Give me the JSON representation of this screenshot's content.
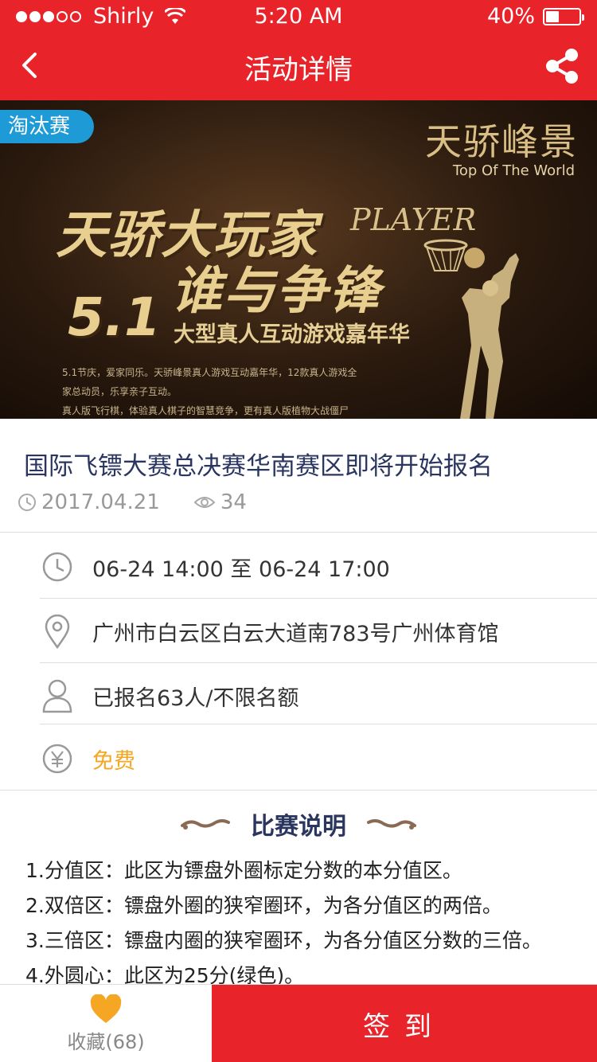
{
  "status_bar": {
    "carrier": "Shirly",
    "time": "5:20 AM",
    "battery": "40%",
    "battery_level": 0.4
  },
  "nav": {
    "title": "活动详情",
    "back_icon": "chevron-left-icon",
    "share_icon": "share-icon"
  },
  "banner": {
    "tag": "淘汰赛",
    "brand_cn": "天骄峰景",
    "brand_en": "Top Of The World",
    "headline_1": "天骄大玩家",
    "player_word": "PLAYER",
    "headline_2": "谁与争锋",
    "big_date": "5.1",
    "sub_headline": "大型真人互动游戏嘉年华",
    "copy_line_1": "5.1节庆，爱家同乐。天骄峰景真人游戏互动嘉年华，12款真人游戏全",
    "copy_line_2": "家总动员，乐享亲子互动。",
    "copy_line_3": "真人版飞行棋，体验真人棋子的智慧竞争，更有真人版植物大战僵尸"
  },
  "event": {
    "title": "国际飞镖大赛总决赛华南赛区即将开始报名",
    "date": "2017.04.21",
    "views": "34"
  },
  "details": {
    "time": "06-24 14:00 至 06-24 17:00",
    "location": "广州市白云区白云大道南783号广州体育馆",
    "signup": "已报名63人/不限名额",
    "price": "免费"
  },
  "description": {
    "title": "比赛说明",
    "rules": [
      "1.分值区：此区为镖盘外圈标定分数的本分值区。",
      "2.双倍区：镖盘外圈的狭窄圈环，为各分值区的两倍。",
      "3.三倍区：镖盘内圈的狭窄圈环，为各分值区分数的三倍。",
      "4.外圆心：此区为25分(绿色)。"
    ]
  },
  "bottom": {
    "favorite_label": "收藏(68)",
    "signin_label": "签到"
  },
  "colors": {
    "primary": "#e8232a",
    "tag_blue": "#1e9bd7",
    "title_navy": "#2b3660",
    "free_orange": "#f5a623",
    "heart_orange": "#f5a623"
  }
}
